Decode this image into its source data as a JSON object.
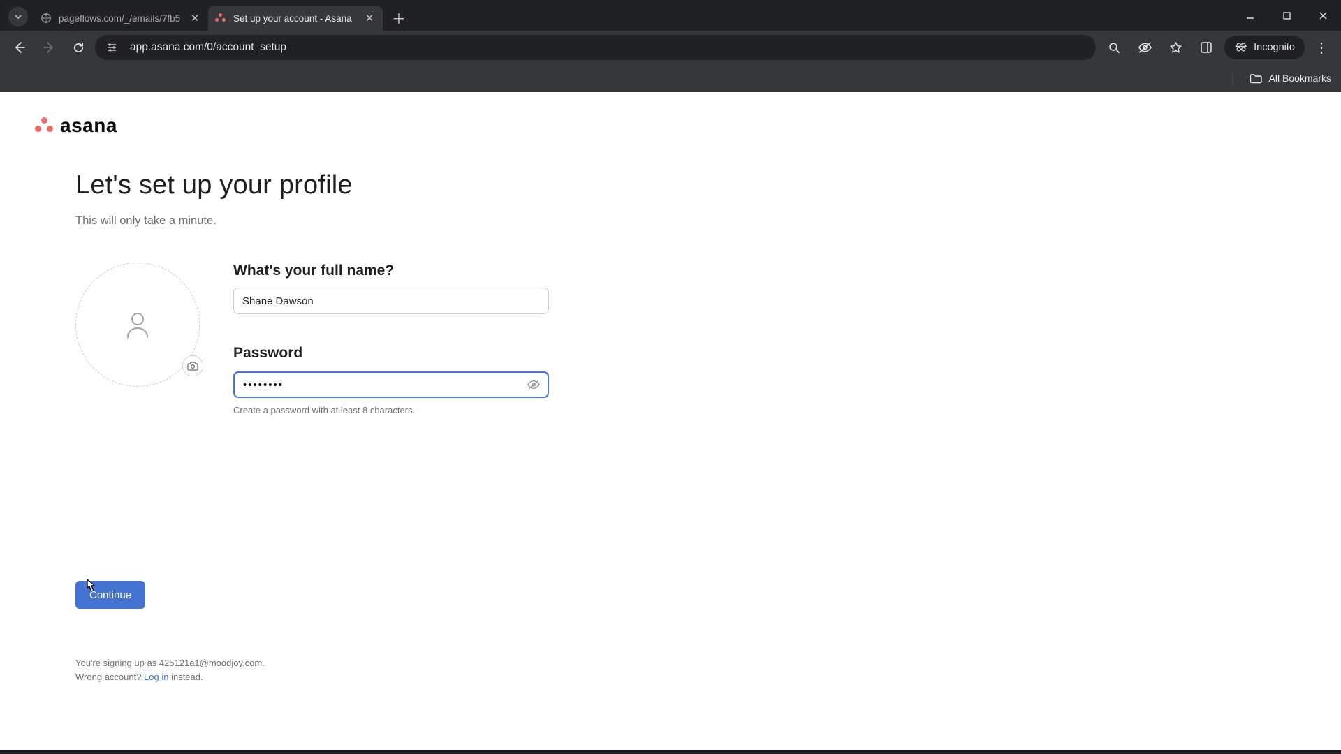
{
  "browser": {
    "tabs": [
      {
        "title": "pageflows.com/_/emails/7fb5"
      },
      {
        "title": "Set up your account - Asana"
      }
    ],
    "url": "app.asana.com/0/account_setup",
    "incognito_label": "Incognito",
    "all_bookmarks_label": "All Bookmarks"
  },
  "logo_text": "asana",
  "heading": "Let's set up your profile",
  "subheading": "This will only take a minute.",
  "fields": {
    "name_label": "What's your full name?",
    "name_value": "Shane Dawson",
    "password_label": "Password",
    "password_value": "••••••••",
    "password_hint": "Create a password with at least 8 characters."
  },
  "continue_label": "Continue",
  "footer": {
    "line1_prefix": "You're signing up as ",
    "line1_email": "425121a1@moodjoy.com",
    "line1_suffix": ".",
    "line2_prefix": "Wrong account? ",
    "login_link": "Log in",
    "line2_suffix": " instead."
  }
}
